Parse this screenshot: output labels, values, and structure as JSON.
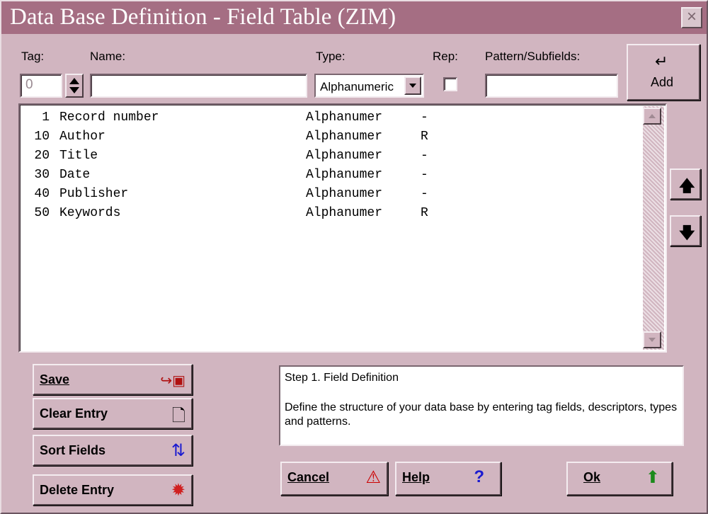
{
  "window": {
    "title": "Data Base Definition - Field Table (ZIM)",
    "close_symbol": "×"
  },
  "form": {
    "tag_label": "Tag:",
    "tag_value": "0",
    "name_label": "Name:",
    "name_value": "",
    "type_label": "Type:",
    "type_value": "Alphanumeric",
    "rep_label": "Rep:",
    "rep_checked": false,
    "pattern_label": "Pattern/Subfields:",
    "pattern_value": ""
  },
  "add_button": {
    "label": "Add",
    "icon": "return-arrow-icon",
    "symbol": "↵"
  },
  "fields": [
    {
      "tag": "1",
      "name": "Record number",
      "type": "Alphanumer",
      "rep": "-"
    },
    {
      "tag": "10",
      "name": "Author",
      "type": "Alphanumer",
      "rep": "R"
    },
    {
      "tag": "20",
      "name": "Title",
      "type": "Alphanumer",
      "rep": "-"
    },
    {
      "tag": "30",
      "name": "Date",
      "type": "Alphanumer",
      "rep": "-"
    },
    {
      "tag": "40",
      "name": "Publisher",
      "type": "Alphanumer",
      "rep": "-"
    },
    {
      "tag": "50",
      "name": "Keywords",
      "type": "Alphanumer",
      "rep": "R"
    }
  ],
  "move_buttons": {
    "up_symbol": "🡅",
    "down_symbol": "🡇"
  },
  "actions": {
    "save": {
      "label": "Save",
      "accel": "S",
      "icon": "save-disk-icon",
      "symbol": "↪▣"
    },
    "clear": {
      "label": "Clear Entry",
      "icon": "new-page-icon",
      "symbol": "🗋"
    },
    "sort": {
      "label": "Sort Fields",
      "icon": "sort-numbers-icon",
      "symbol": "⇅"
    },
    "delete": {
      "label": "Delete Entry",
      "icon": "explosion-icon",
      "symbol": "✹"
    }
  },
  "help": {
    "heading": "Step 1. Field Definition",
    "body": "Define the structure of your data base by entering tag fields, descriptors, types and patterns."
  },
  "dialog_buttons": {
    "cancel": {
      "label": "Cancel",
      "icon": "warning-triangle-icon",
      "symbol": "⚠"
    },
    "help": {
      "label": "Help",
      "icon": "question-mark-icon",
      "symbol": "?"
    },
    "ok": {
      "label": "Ok",
      "icon": "green-up-arrow-icon",
      "symbol": "⬆"
    }
  },
  "colors": {
    "window_bg": "#d1b5c0",
    "titlebar": "#a56e83",
    "ok_icon": "#1c8a1c",
    "help_icon": "#1a1ad0",
    "warning_icon": "#cc0000"
  }
}
